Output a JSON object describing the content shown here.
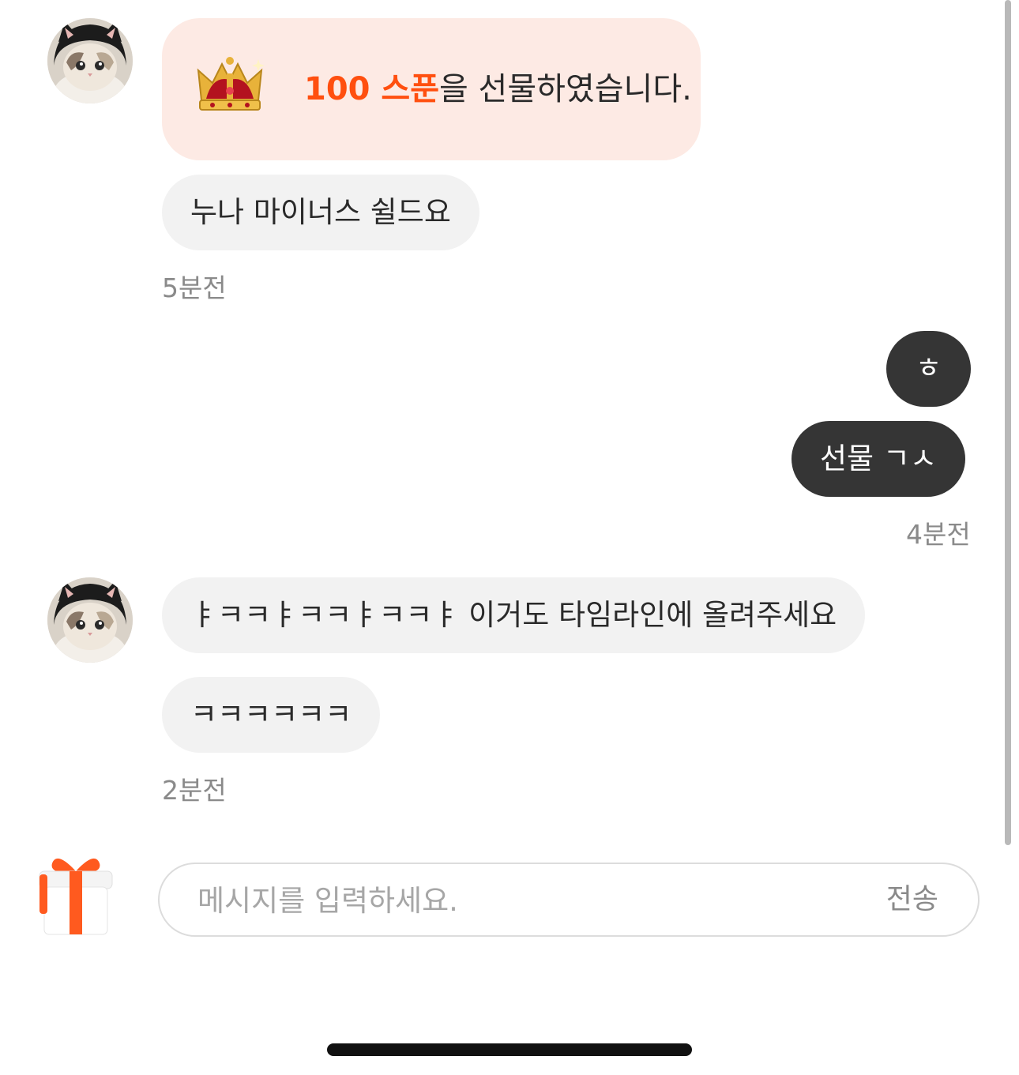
{
  "messages": {
    "gift": {
      "amount": "100 스푼",
      "text": "을 선물하였습니다."
    },
    "group1": {
      "msg1": "누나 마이너스 쉴드요",
      "time": "5분전"
    },
    "group2": {
      "msg1": "ㅎ",
      "msg2": "선물 ㄱㅅ",
      "time": "4분전"
    },
    "group3": {
      "msg1": "ㅑㅋㅋㅑㅋㅋㅑㅋㅋㅑ 이거도 타임라인에 올려주세요",
      "msg2": "ㅋㅋㅋㅋㅋㅋ",
      "time": "2분전"
    }
  },
  "composer": {
    "placeholder": "메시지를 입력하세요.",
    "send_label": "전송"
  },
  "icons": {
    "avatar": "cat-avatar-icon",
    "crown": "crown-icon",
    "gift": "gift-box-icon"
  },
  "colors": {
    "accent": "#ff4f0f",
    "outgoing_bubble": "#353535",
    "incoming_bubble": "#f2f2f2",
    "gift_card": "#fdeae4"
  }
}
